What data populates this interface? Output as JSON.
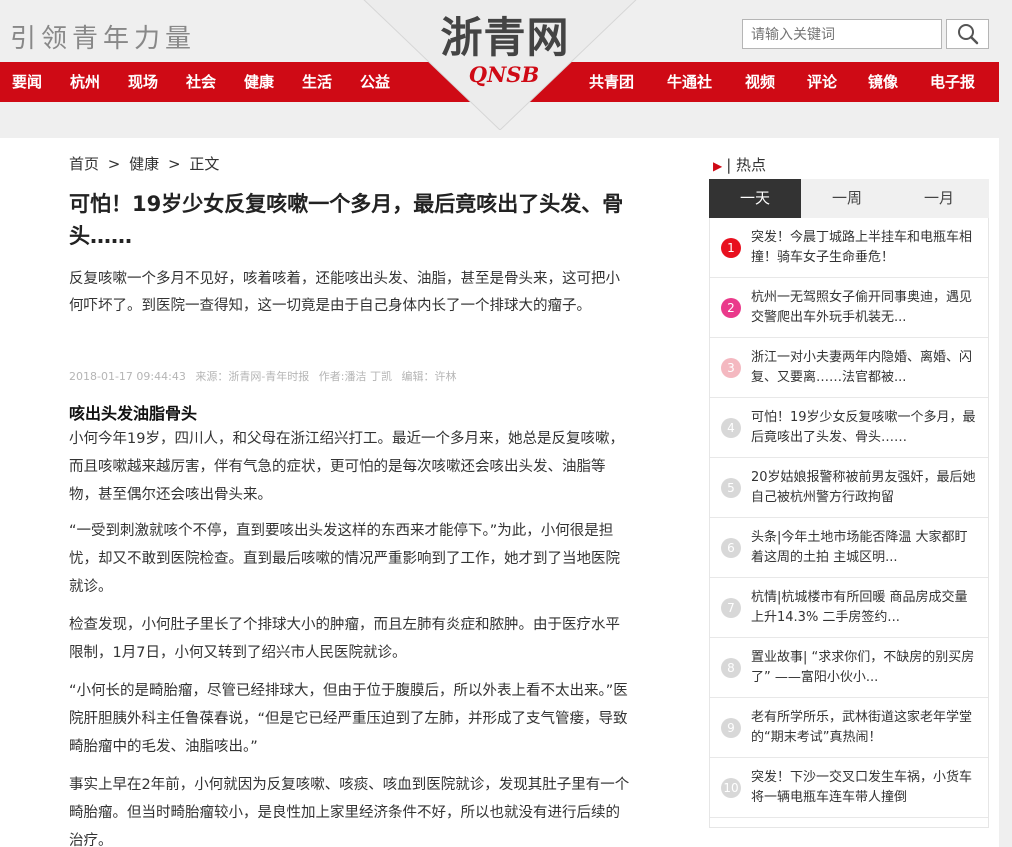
{
  "header": {
    "slogan": "引领青年力量",
    "logo_text": "浙青网",
    "logo_sub": "QNSB",
    "search_placeholder": "请输入关键词",
    "brand_color": "#cf0a15"
  },
  "nav": {
    "left": [
      "要闻",
      "杭州",
      "现场",
      "社会",
      "健康",
      "生活",
      "公益"
    ],
    "right": [
      "共青团",
      "牛通社",
      "视频",
      "评论",
      "镜像",
      "电子报"
    ]
  },
  "breadcrumb": {
    "home": "首页",
    "sep1": ">",
    "section": "健康",
    "sep2": ">",
    "current": "正文"
  },
  "article": {
    "title": "可怕！19岁少女反复咳嗽一个多月，最后竟咳出了头发、骨头……",
    "summary": "反复咳嗽一个多月不见好，咳着咳着，还能咳出头发、油脂，甚至是骨头来，这可把小何吓坏了。到医院一查得知，这一切竟是由于自己身体内长了一个排球大的瘤子。",
    "meta": {
      "time": "2018-01-17 09:44:43",
      "source": "来源：浙青网-青年时报",
      "author": "作者:潘洁 丁凯",
      "editor": "编辑：许林"
    },
    "subhead": "咳出头发油脂骨头",
    "paragraphs": [
      "小何今年19岁，四川人，和父母在浙江绍兴打工。最近一个多月来，她总是反复咳嗽，而且咳嗽越来越厉害，伴有气急的症状，更可怕的是每次咳嗽还会咳出头发、油脂等物，甚至偶尔还会咳出骨头来。",
      "“一受到刺激就咳个不停，直到要咳出头发这样的东西来才能停下。”为此，小何很是担忧，却又不敢到医院检查。直到最后咳嗽的情况严重影响到了工作，她才到了当地医院就诊。",
      "检查发现，小何肚子里长了个排球大小的肿瘤，而且左肺有炎症和脓肿。由于医疗水平限制，1月7日，小何又转到了绍兴市人民医院就诊。",
      "“小何长的是畸胎瘤，尽管已经排球大，但由于位于腹膜后，所以外表上看不太出来。”医院肝胆胰外科主任鲁葆春说，“但是它已经严重压迫到了左肺，并形成了支气管瘘，导致畸胎瘤中的毛发、油脂咳出。”",
      "事实上早在2年前，小何就因为反复咳嗽、咳痰、咳血到医院就诊，发现其肚子里有一个畸胎瘤。但当时畸胎瘤较小，是良性加上家里经济条件不好，所以也就没有进行后续的治疗。"
    ]
  },
  "sidebar": {
    "hot_title": "| 热点",
    "tabs": [
      "一天",
      "一周",
      "一月"
    ],
    "items": [
      {
        "num": "1",
        "text": "突发！今晨丁城路上半挂车和电瓶车相撞！骑车女子生命垂危！",
        "color": "#e8101f"
      },
      {
        "num": "2",
        "text": "杭州一无驾照女子偷开同事奥迪，遇见交警爬出车外玩手机装无...",
        "color": "#ea3a8b"
      },
      {
        "num": "3",
        "text": "浙江一对小夫妻两年内隐婚、离婚、闪复、又要离……法官都被...",
        "color": "#f4b8c0"
      },
      {
        "num": "4",
        "text": "可怕！19岁少女反复咳嗽一个多月，最后竟咳出了头发、骨头……",
        "color": "#d8d8d8"
      },
      {
        "num": "5",
        "text": "20岁姑娘报警称被前男友强奸，最后她自己被杭州警方行政拘留",
        "color": "#d8d8d8"
      },
      {
        "num": "6",
        "text": "头条|今年土地市场能否降温 大家都盯着这周的土拍 主城区明...",
        "color": "#d8d8d8"
      },
      {
        "num": "7",
        "text": "杭情|杭城楼市有所回暖 商品房成交量上升14.3% 二手房签约...",
        "color": "#d8d8d8"
      },
      {
        "num": "8",
        "text": "置业故事| “求求你们，不缺房的别买房了” ——富阳小伙小...",
        "color": "#d8d8d8"
      },
      {
        "num": "9",
        "text": "老有所学所乐，武林街道这家老年学堂的“期末考试”真热闹！",
        "color": "#d8d8d8"
      },
      {
        "num": "10",
        "text": "突发！下沙一交叉口发生车祸，小货车将一辆电瓶车连车带人撞倒",
        "color": "#d8d8d8"
      }
    ]
  }
}
